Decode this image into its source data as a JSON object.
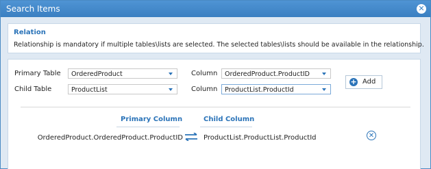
{
  "window": {
    "title": "Search Items",
    "close_icon": "close-circle-icon"
  },
  "relation": {
    "title": "Relation",
    "description": "Relationship is mandatory if multiple tables\\lists are selected. The selected tables\\lists should be available in the relationship."
  },
  "form": {
    "primary_table_label": "Primary Table",
    "primary_table_value": "OrderedProduct",
    "child_table_label": "Child Table",
    "child_table_value": "ProductList",
    "column_label_1": "Column",
    "column_value_1": "OrderedProduct.ProductID",
    "column_label_2": "Column",
    "column_value_2": "ProductList.ProductId",
    "add_label": "Add"
  },
  "relationship_table": {
    "headers": {
      "primary": "Primary Column",
      "child": "Child Column"
    },
    "rows": [
      {
        "primary": "OrderedProduct.OrderedProduct.ProductID",
        "child": "ProductList.ProductList.ProductId"
      }
    ]
  },
  "colors": {
    "accent": "#2a73b8",
    "titlebar": "#3f86c8"
  }
}
